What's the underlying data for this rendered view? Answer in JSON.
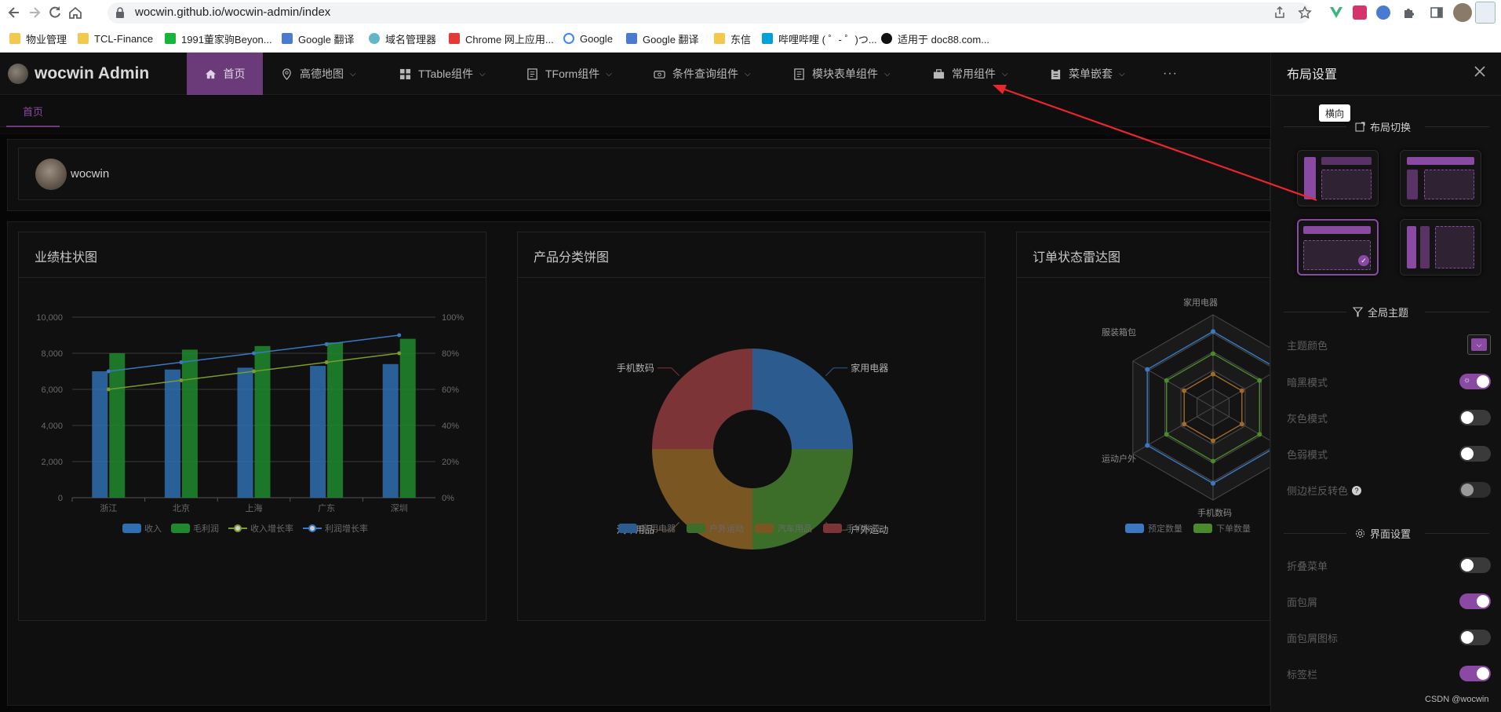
{
  "browser": {
    "url": "wocwin.github.io/wocwin-admin/index",
    "bookmarks": [
      "物业管理",
      "TCL-Finance",
      "1991董家驹Beyon...",
      "Google 翻译",
      "域名管理器",
      "Chrome 网上应用...",
      "Google",
      "Google 翻译",
      "东信",
      "哔哩哔哩 ( ゜- ゜)つ...",
      "适用于 doc88.com..."
    ]
  },
  "app": {
    "brand": "wocwin Admin",
    "menu": [
      {
        "label": "首页",
        "icon": "home-icon"
      },
      {
        "label": "高德地图",
        "icon": "map-pin-icon"
      },
      {
        "label": "TTable组件",
        "icon": "grid-icon"
      },
      {
        "label": "TForm组件",
        "icon": "document-icon"
      },
      {
        "label": "条件查询组件",
        "icon": "search-box-icon"
      },
      {
        "label": "模块表单组件",
        "icon": "document-icon"
      },
      {
        "label": "常用组件",
        "icon": "briefcase-icon"
      },
      {
        "label": "菜单嵌套",
        "icon": "clipboard-icon"
      }
    ],
    "more": "···",
    "tab": "首页",
    "user": "wocwin"
  },
  "cards": {
    "bar": {
      "title": "业绩柱状图"
    },
    "pie": {
      "title": "产品分类饼图"
    },
    "radar": {
      "title": "订单状态雷达图"
    }
  },
  "chart_data": [
    {
      "type": "bar",
      "title": "业绩柱状图",
      "categories": [
        "浙江",
        "北京",
        "上海",
        "广东",
        "深圳"
      ],
      "ylim": [
        0,
        10000
      ],
      "y_ticks": [
        "0",
        "2,000",
        "4,000",
        "6,000",
        "8,000",
        "10,000"
      ],
      "y2lim": [
        0,
        100
      ],
      "y2_ticks": [
        "0%",
        "20%",
        "40%",
        "60%",
        "80%",
        "100%"
      ],
      "series": [
        {
          "name": "收入",
          "type": "bar",
          "values": [
            7000,
            7100,
            7200,
            7300,
            7400
          ],
          "color": "#2f6fb0"
        },
        {
          "name": "毛利润",
          "type": "bar",
          "values": [
            8000,
            8200,
            8400,
            8600,
            8800
          ],
          "color": "#1e8a2e"
        },
        {
          "name": "收入增长率",
          "type": "line",
          "axis": "right",
          "values": [
            60,
            65,
            70,
            75,
            80
          ],
          "color": "#7a9b2e"
        },
        {
          "name": "利润增长率",
          "type": "line",
          "axis": "right",
          "values": [
            70,
            75,
            80,
            85,
            90
          ],
          "color": "#3a78c2"
        }
      ],
      "legend": "bottom",
      "grid": true
    },
    {
      "type": "pie",
      "title": "产品分类饼图",
      "slices": [
        {
          "name": "家用电器",
          "value": 25,
          "color": "#2b5b8f"
        },
        {
          "name": "户外运动",
          "value": 25,
          "color": "#3c6e2a"
        },
        {
          "name": "汽车用品",
          "value": 25,
          "color": "#7a5623"
        },
        {
          "name": "手机数码",
          "value": 25,
          "color": "#7d3436"
        }
      ],
      "legend": "bottom"
    },
    {
      "type": "radar",
      "title": "订单状态雷达图",
      "indicators": [
        "家用电器",
        "服装箱包",
        "运动户外",
        "手机数码"
      ],
      "series": [
        {
          "name": "预定数量",
          "color": "#3a78c2"
        },
        {
          "name": "下单数量",
          "color": "#4a8a2a"
        }
      ],
      "legend": "bottom"
    }
  ],
  "drawer": {
    "title": "布局设置",
    "section_layout": "布局切换",
    "tooltip": "横向",
    "section_theme": "全局主题",
    "theme_color_label": "主题颜色",
    "dark_label": "暗黑模式",
    "gray_label": "灰色模式",
    "weak_label": "色弱模式",
    "sidebar_invert_label": "侧边栏反转色",
    "section_ui": "界面设置",
    "collapse_label": "折叠菜单",
    "breadcrumb_label": "面包屑",
    "breadcrumb_icon_label": "面包屑图标",
    "tabs_label": "标签栏",
    "accent": "#8a4aa3"
  },
  "watermark": "CSDN @wocwin"
}
